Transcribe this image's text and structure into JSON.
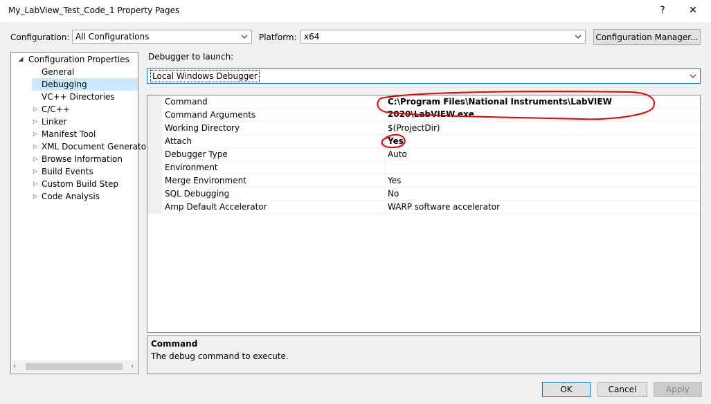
{
  "window": {
    "title": "My_LabView_Test_Code_1 Property Pages",
    "help_label": "?",
    "close_label": "✕"
  },
  "config_bar": {
    "configuration_label": "Configuration:",
    "configuration_value": "All Configurations",
    "platform_label": "Platform:",
    "platform_value": "x64",
    "manager_button": "Configuration Manager..."
  },
  "tree": {
    "root": "Configuration Properties",
    "items": [
      {
        "label": "General",
        "expandable": false,
        "selected": false
      },
      {
        "label": "Debugging",
        "expandable": false,
        "selected": true
      },
      {
        "label": "VC++ Directories",
        "expandable": false,
        "selected": false
      },
      {
        "label": "C/C++",
        "expandable": true,
        "selected": false
      },
      {
        "label": "Linker",
        "expandable": true,
        "selected": false
      },
      {
        "label": "Manifest Tool",
        "expandable": true,
        "selected": false
      },
      {
        "label": "XML Document Generator",
        "expandable": true,
        "selected": false
      },
      {
        "label": "Browse Information",
        "expandable": true,
        "selected": false
      },
      {
        "label": "Build Events",
        "expandable": true,
        "selected": false
      },
      {
        "label": "Custom Build Step",
        "expandable": true,
        "selected": false
      },
      {
        "label": "Code Analysis",
        "expandable": true,
        "selected": false
      }
    ]
  },
  "debugger": {
    "launch_label": "Debugger to launch:",
    "launch_value": "Local Windows Debugger"
  },
  "properties": [
    {
      "name": "Command",
      "value": "C:\\Program Files\\National Instruments\\LabVIEW 2020\\LabVIEW.exe",
      "bold": true
    },
    {
      "name": "Command Arguments",
      "value": "",
      "bold": false
    },
    {
      "name": "Working Directory",
      "value": "$(ProjectDir)",
      "bold": false
    },
    {
      "name": "Attach",
      "value": "Yes",
      "bold": true
    },
    {
      "name": "Debugger Type",
      "value": "Auto",
      "bold": false
    },
    {
      "name": "Environment",
      "value": "",
      "bold": false
    },
    {
      "name": "Merge Environment",
      "value": "Yes",
      "bold": false
    },
    {
      "name": "SQL Debugging",
      "value": "No",
      "bold": false
    },
    {
      "name": "Amp Default Accelerator",
      "value": "WARP software accelerator",
      "bold": false
    }
  ],
  "description": {
    "title": "Command",
    "text": "The debug command to execute."
  },
  "footer": {
    "ok": "OK",
    "cancel": "Cancel",
    "apply": "Apply"
  },
  "colors": {
    "selection": "#cce8ff",
    "annotation": "#e00000",
    "accent_border": "#0078d7"
  }
}
